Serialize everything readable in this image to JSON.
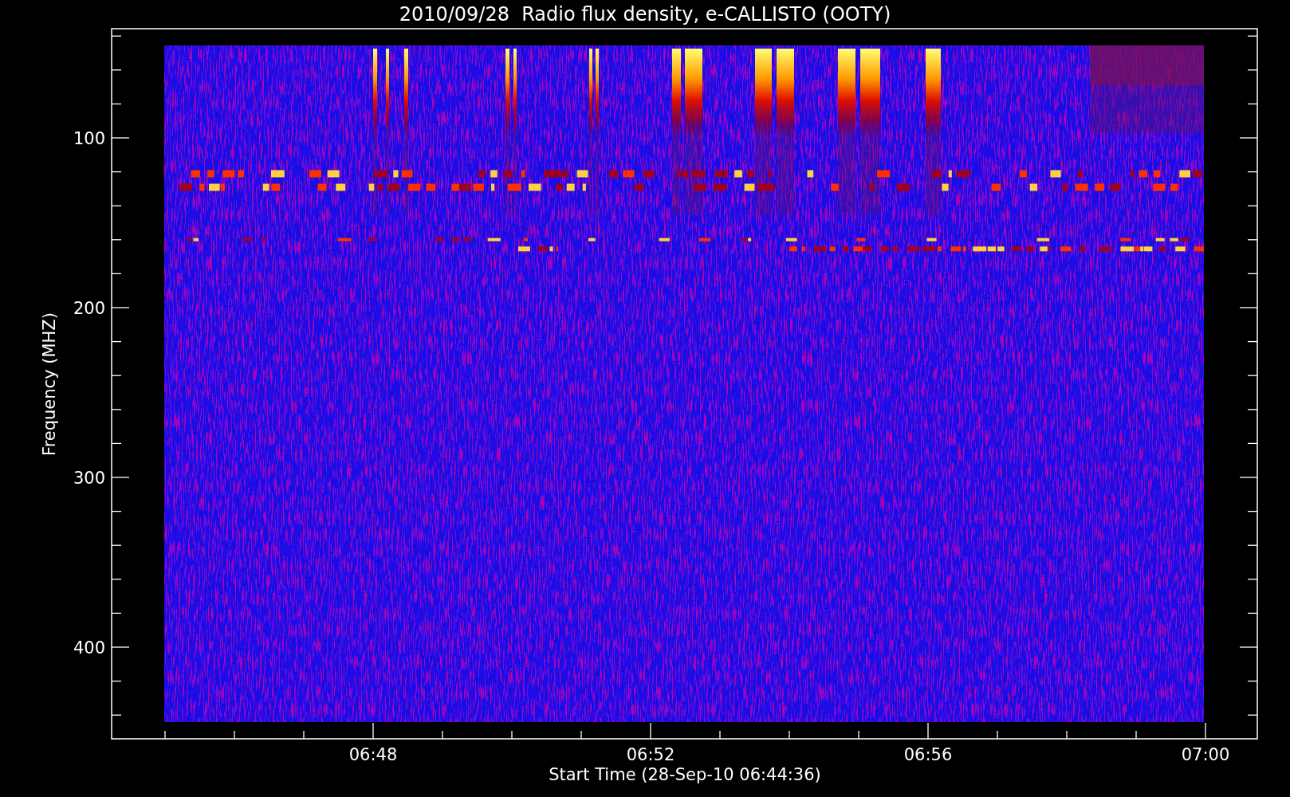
{
  "title": "2010/09/28  Radio flux density, e-CALLISTO (OOTY)",
  "y_axis": {
    "label": "Frequency (MHZ)",
    "tick_labels": [
      "100",
      "200",
      "300",
      "400"
    ]
  },
  "x_axis": {
    "label": "Start Time (28-Sep-10 06:44:36)",
    "tick_labels": [
      "06:48",
      "06:52",
      "06:56",
      "07:00"
    ]
  }
}
